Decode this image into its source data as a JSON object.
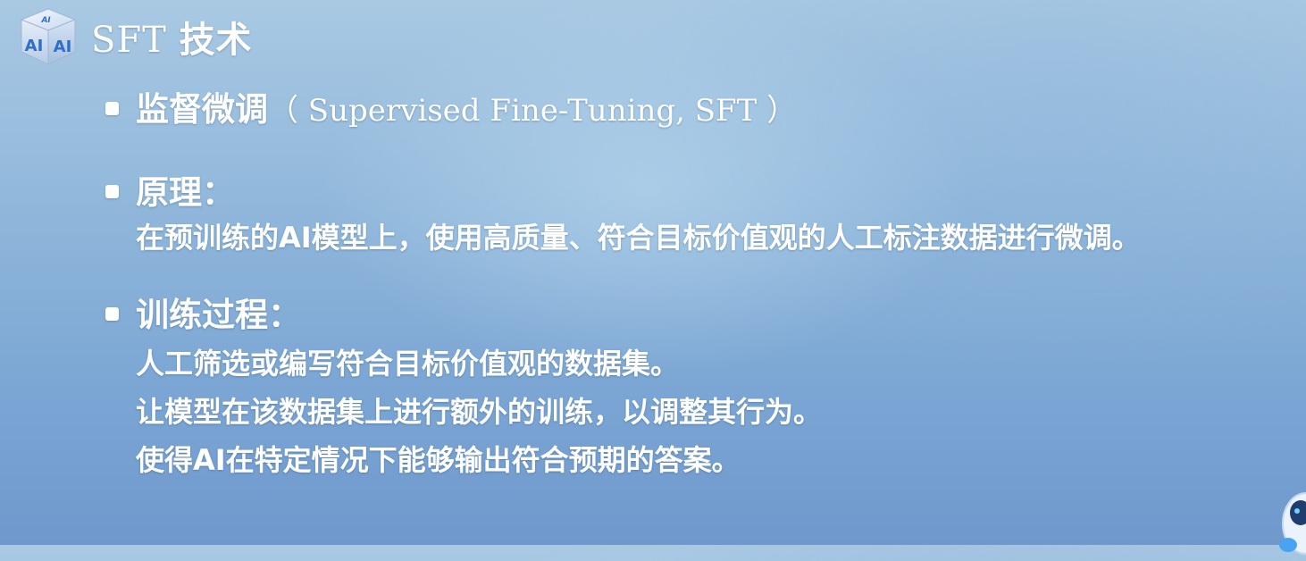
{
  "header": {
    "title_en": "SFT",
    "title_zh": "技术",
    "logo_text_left": "AI",
    "logo_text_right": "AI",
    "logo_text_top": "AI"
  },
  "items": [
    {
      "heading": "监督微调",
      "heading_paren": "（ Supervised Fine-Tuning, SFT ）"
    },
    {
      "heading": "原理：",
      "body": "在预训练的AI模型上，使用高质量、符合目标价值观的人工标注数据进行微调。"
    },
    {
      "heading": "训练过程：",
      "lines": [
        "人工筛选或编写符合目标价值观的数据集。",
        "让模型在该数据集上进行额外的训练，以调整其行为。",
        "使得AI在特定情况下能够输出符合预期的答案。"
      ]
    }
  ],
  "colors": {
    "text": "#ffffff",
    "background_top": "#a9c9e3",
    "background_bottom": "#6f99cc",
    "logo_blue": "#2f6fc6"
  }
}
